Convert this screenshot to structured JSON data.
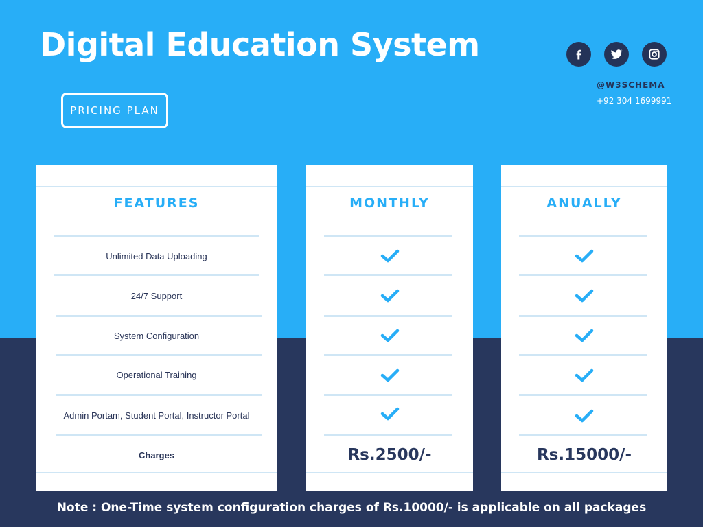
{
  "header": {
    "title": "Digital Education System",
    "pricing_label": "PRICING PLAN"
  },
  "contact": {
    "social_icons": [
      "facebook-icon",
      "twitter-icon",
      "instagram-icon"
    ],
    "handle": "@W3SCHEMA",
    "phone": "+92 304 1699991"
  },
  "colors": {
    "top_band": "#28aef7",
    "bottom_band": "#28375d",
    "accent": "#28aef7",
    "card": "#ffffff"
  },
  "table": {
    "features_header": "FEATURES",
    "plans": [
      {
        "name": "MONTHLY",
        "price": "Rs.2500/-"
      },
      {
        "name": "ANUALLY",
        "price": "Rs.15000/-"
      }
    ],
    "features": [
      "Unlimited Data Uploading",
      "24/7 Support",
      "System Configuration",
      "Operational Training",
      "Admin Portam, Student Portal, Instructor Portal"
    ],
    "charges_label": "Charges",
    "check_icon": "checkmark-icon"
  },
  "note": "Note : One-Time system configuration charges of Rs.10000/- is applicable on all packages"
}
